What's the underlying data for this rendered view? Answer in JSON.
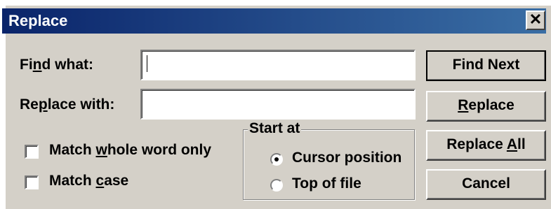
{
  "dialog": {
    "title": "Replace",
    "close_glyph": "✕"
  },
  "find": {
    "label_pre": "Fi",
    "label_key": "n",
    "label_post": "d what:",
    "value": ""
  },
  "replace": {
    "label_pre": "Re",
    "label_key": "p",
    "label_post": "lace with:",
    "value": ""
  },
  "options": {
    "whole_word": {
      "label_pre": "Match ",
      "label_key": "w",
      "label_post": "hole word only",
      "checked": false
    },
    "match_case": {
      "label_pre": "Match ",
      "label_key": "c",
      "label_post": "ase",
      "checked": false
    }
  },
  "start_at": {
    "legend": "Start at",
    "cursor": {
      "label": "Cursor position",
      "selected": true
    },
    "top": {
      "label": "Top of file",
      "selected": false
    }
  },
  "buttons": {
    "find_next": "Find Next",
    "replace_pre": "",
    "replace_key": "R",
    "replace_post": "eplace",
    "replace_all_pre": "Replace ",
    "replace_all_key": "A",
    "replace_all_post": "ll",
    "cancel": "Cancel"
  },
  "icons": {
    "close": "close-icon",
    "radio_selected": "radio-dot"
  }
}
